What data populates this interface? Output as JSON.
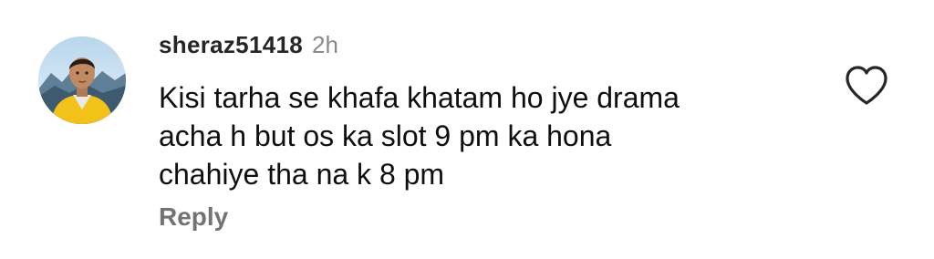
{
  "comment": {
    "username": "sheraz51418",
    "timestamp": "2h",
    "text": "Kisi tarha se khafa khatam ho jye  drama\nacha h but os ka slot 9 pm ka hona\nchahiye tha na k 8 pm",
    "reply_label": "Reply",
    "avatar_icon": "user-avatar-photo",
    "like_icon": "heart-outline-icon"
  },
  "colors": {
    "username": "#262626",
    "timestamp": "#8a8a8a",
    "text": "#0f0f0f",
    "reply": "#737373",
    "avatar_shirt": "#f2c21b"
  }
}
